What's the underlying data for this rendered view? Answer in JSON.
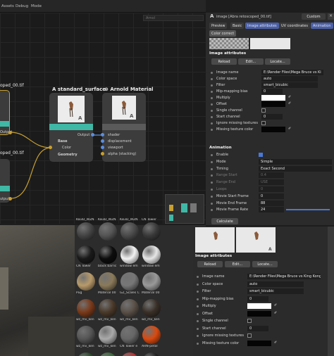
{
  "menubar": {
    "items": [
      "Assets",
      "Debug",
      "Mode"
    ]
  },
  "node_editor": {
    "filter_placeholder": "Arnol",
    "nodes": {
      "left_top_label": "oped_00.tif",
      "left_top_port": "Output",
      "left_bottom_label": "oped_00.tif",
      "left_bottom_port": "utput",
      "standard_surface": {
        "title": "standard_surface",
        "output": "Output",
        "base": "Base",
        "color": "Color",
        "geometry": "Geometry"
      },
      "arnold_material": {
        "title": "Arnold Material",
        "ports": [
          "shader",
          "displacement",
          "viewport",
          "alpha (stacking)"
        ]
      }
    }
  },
  "material_browser": {
    "rows": [
      [
        "KB3D_WZN",
        "KB3D_WZN",
        "KB3D_WZN",
        "CN Tower"
      ],
      [
        "CN Tower",
        "black barric",
        "window em",
        "window em"
      ],
      [
        "Pug",
        "Material 00",
        "GZ_Scales C",
        "Material 00"
      ],
      [
        "wz_mv_ken",
        "wz_mv_ken",
        "wz_mv_ken",
        "wz_mv_ken"
      ],
      [
        "wz_mv_ken",
        "wz_mv_ken",
        "CN Tower e",
        "ARN-petal"
      ],
      [
        "",
        "",
        "",
        ""
      ]
    ]
  },
  "attr_top": {
    "header_title": "image [Abra retoscoped_00.tif]",
    "custom_button": "Custom",
    "tabs": [
      "Preview",
      "Basic",
      "Image attributes",
      "UV coordinates",
      "Animation"
    ],
    "color_correct_button": "Color correct",
    "section_image_attributes": "Image attributes",
    "reload": "Reload",
    "edit": "Edit...",
    "locate": "Locate...",
    "rows": {
      "image_name": {
        "label": "Image name",
        "value": "E:\\Render Files\\Mega Bruce vs Ki"
      },
      "color_space": {
        "label": "Color space",
        "value": "auto"
      },
      "filter": {
        "label": "Filter",
        "value": "smart_bicubic"
      },
      "mip_bias": {
        "label": "Mip-mapping bias",
        "value": "0"
      },
      "multiply": {
        "label": "Multiply"
      },
      "offset": {
        "label": "Offset"
      },
      "single_channel": {
        "label": "Single channel"
      },
      "start_channel": {
        "label": "Start channel",
        "value": "0"
      },
      "ignore_missing": {
        "label": "Ignore missing textures"
      },
      "missing_color": {
        "label": "Missing texture color"
      }
    },
    "section_animation": "Animation",
    "anim": {
      "enable": {
        "label": "Enable"
      },
      "mode": {
        "label": "Mode",
        "value": "Simple"
      },
      "timing": {
        "label": "Timing",
        "value": "Exact Second"
      },
      "range_start": {
        "label": "Range Start",
        "value": "0.4"
      },
      "range_end": {
        "label": "Range End",
        "value": "USE"
      },
      "loops": {
        "label": "Loops",
        "value": "0"
      },
      "movie_start": {
        "label": "Movie Start Frame",
        "value": "0"
      },
      "movie_end": {
        "label": "Movie End Frame",
        "value": "88"
      },
      "movie_rate": {
        "label": "Movie Frame Rate",
        "value": "24"
      }
    },
    "calculate": "Calculate"
  },
  "attr_bottom": {
    "section_image_attributes": "Image attributes",
    "reload": "Reload",
    "edit": "Edit...",
    "locate": "Locate...",
    "rows": {
      "image_name": {
        "label": "Image name",
        "value": "E:\\Render Files\\Mega Bruce vs King Kong\\Vc"
      },
      "color_space": {
        "label": "Color space",
        "value": "auto"
      },
      "filter": {
        "label": "Filter",
        "value": "smart_bicubic"
      },
      "mip_bias": {
        "label": "Mip-mapping bias",
        "value": "0"
      },
      "multiply": {
        "label": "Multiply"
      },
      "offset": {
        "label": "Offset"
      },
      "single_channel": {
        "label": "Single channel"
      },
      "start_channel": {
        "label": "Start channel",
        "value": "0"
      },
      "ignore_missing": {
        "label": "Ignore missing textures"
      },
      "missing_color": {
        "label": "Missing texture color"
      }
    }
  },
  "colors": {
    "accent": "#4a5fa8",
    "node_header_teal": "#3fb8a6",
    "wire_yellow": "#c8a030",
    "checkbox_on": "#4a78d8"
  }
}
